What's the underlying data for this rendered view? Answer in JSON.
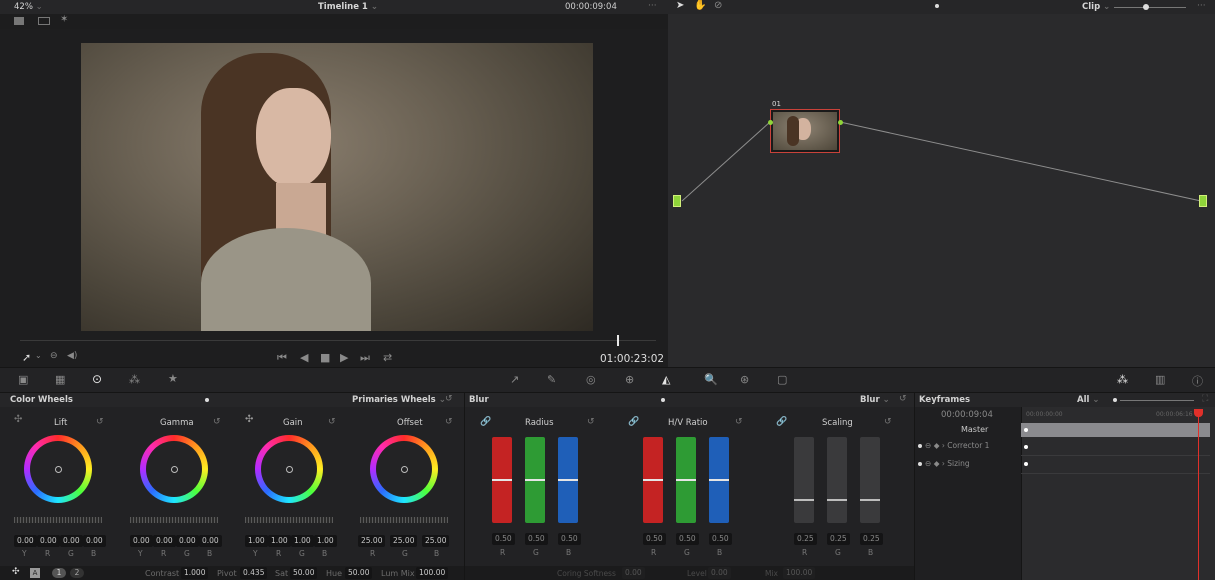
{
  "viewer": {
    "zoom": "42%",
    "timeline_name": "Timeline 1",
    "source_timecode": "00:00:09:04",
    "record_timecode": "01:00:23:02"
  },
  "node_editor": {
    "mode": "Clip",
    "node_label": "01"
  },
  "color_wheels": {
    "panel_title": "Color Wheels",
    "mode": "Primaries Wheels",
    "wheels": [
      {
        "label": "Lift",
        "values": [
          "0.00",
          "0.00",
          "0.00",
          "0.00"
        ],
        "channels": [
          "Y",
          "R",
          "G",
          "B"
        ]
      },
      {
        "label": "Gamma",
        "values": [
          "0.00",
          "0.00",
          "0.00",
          "0.00"
        ],
        "channels": [
          "Y",
          "R",
          "G",
          "B"
        ]
      },
      {
        "label": "Gain",
        "values": [
          "1.00",
          "1.00",
          "1.00",
          "1.00"
        ],
        "channels": [
          "Y",
          "R",
          "G",
          "B"
        ]
      },
      {
        "label": "Offset",
        "values": [
          "25.00",
          "25.00",
          "25.00"
        ],
        "channels": [
          "R",
          "G",
          "B"
        ]
      }
    ],
    "bottom": {
      "page_1": "1",
      "page_2": "2",
      "contrast_label": "Contrast",
      "contrast": "1.000",
      "pivot_label": "Pivot",
      "pivot": "0.435",
      "sat_label": "Sat",
      "sat": "50.00",
      "hue_label": "Hue",
      "hue": "50.00",
      "lummix_label": "Lum Mix",
      "lummix": "100.00"
    }
  },
  "blur": {
    "panel_title": "Blur",
    "mode": "Blur",
    "groups": [
      {
        "label": "Radius",
        "values": [
          "0.50",
          "0.50",
          "0.50"
        ],
        "channels": [
          "R",
          "G",
          "B"
        ]
      },
      {
        "label": "H/V Ratio",
        "values": [
          "0.50",
          "0.50",
          "0.50"
        ],
        "channels": [
          "R",
          "G",
          "B"
        ]
      },
      {
        "label": "Scaling",
        "values": [
          "0.25",
          "0.25",
          "0.25"
        ],
        "channels": [
          "R",
          "G",
          "B"
        ]
      }
    ],
    "bottom": {
      "coring_label": "Coring Softness",
      "coring": "0.00",
      "level_label": "Level",
      "level": "0.00",
      "mix_label": "Mix",
      "mix": "100.00"
    }
  },
  "keyframes": {
    "panel_title": "Keyframes",
    "filter": "All",
    "timecode": "00:00:09:04",
    "ruler_start": "00:00:00:00",
    "ruler_end": "00:00:06:16",
    "rows": [
      "Master",
      "Corrector 1",
      "Sizing"
    ]
  },
  "colors": {
    "accent_green": "#8fd43a",
    "playhead_red": "#e0302a",
    "node_border": "#c9423a"
  }
}
